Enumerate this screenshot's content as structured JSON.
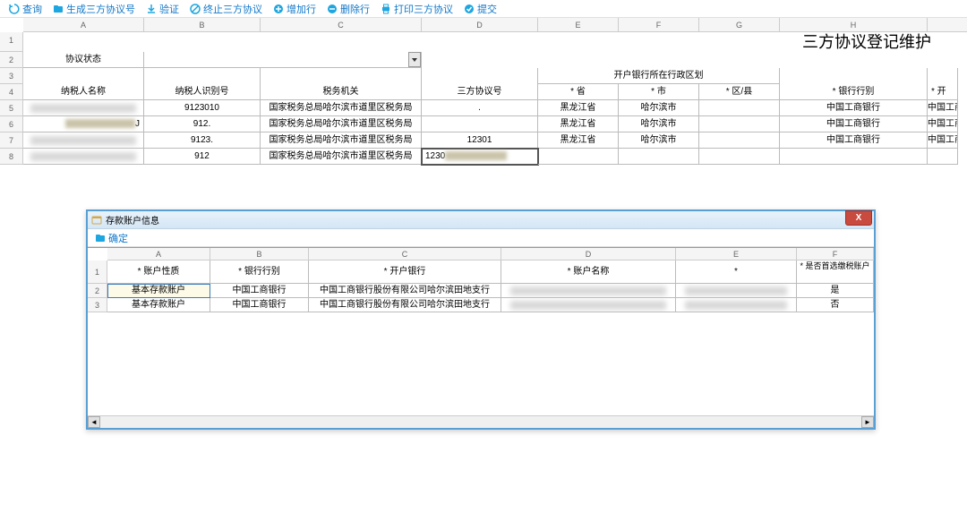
{
  "toolbar": {
    "query": "查询",
    "gen_agreement": "生成三方协议号",
    "verify": "验证",
    "terminate": "终止三方协议",
    "add_row": "增加行",
    "del_row": "删除行",
    "print": "打印三方协议",
    "submit": "提交"
  },
  "main": {
    "cols": [
      "A",
      "B",
      "C",
      "D",
      "E",
      "F",
      "G",
      "H"
    ],
    "row_nums": [
      "1",
      "2",
      "3",
      "4",
      "5",
      "6",
      "7",
      "8"
    ],
    "title": "三方协议登记维护",
    "headers": {
      "status": "协议状态",
      "taxpayer_name": "纳税人名称",
      "taxpayer_id": "纳税人识别号",
      "tax_authority": "税务机关",
      "agreement_no": "三方协议号",
      "bank_district_group": "开户银行所在行政区划",
      "province": "* 省",
      "city": "* 市",
      "county": "* 区/县",
      "bank_type": "* 银行行别",
      "open_bank": "* 开"
    },
    "rows": [
      {
        "name_blur": true,
        "id": "9123010",
        "authority": "国家税务总局哈尔滨市道里区税务局",
        "agreement": ".",
        "province": "黑龙江省",
        "city": "哈尔滨市",
        "county": "",
        "bank_type": "中国工商银行",
        "open_bank": "中国工商银行"
      },
      {
        "name_blur": true,
        "name_suffix": "J",
        "id": "912.",
        "authority": "国家税务总局哈尔滨市道里区税务局",
        "agreement": "",
        "province": "黑龙江省",
        "city": "哈尔滨市",
        "county": "",
        "bank_type": "中国工商银行",
        "open_bank": "中国工商银行"
      },
      {
        "name_blur": true,
        "id": "9123.",
        "authority": "国家税务总局哈尔滨市道里区税务局",
        "agreement": "12301",
        "province": "黑龙江省",
        "city": "哈尔滨市",
        "county": "",
        "bank_type": "中国工商银行",
        "open_bank": "中国工商银行"
      },
      {
        "name_blur": true,
        "id": "912",
        "authority": "国家税务总局哈尔滨市道里区税务局",
        "agreement": "1230",
        "agreement_blur_suffix": true,
        "province": "",
        "city": "",
        "county": "",
        "bank_type": "",
        "open_bank": ""
      }
    ]
  },
  "dialog": {
    "title": "存款账户信息",
    "confirm": "确定",
    "cols": [
      "A",
      "B",
      "C",
      "D",
      "E",
      "F"
    ],
    "row_nums": [
      "1",
      "2",
      "3"
    ],
    "headers": {
      "account_type": "* 账户性质",
      "bank_type": "* 银行行别",
      "open_bank": "* 开户银行",
      "account_name": "* 账户名称",
      "col_e": "*",
      "is_preferred": "* 是否首选缴税账户"
    },
    "rows": [
      {
        "account_type": "基本存款账户",
        "bank_type": "中国工商银行",
        "open_bank": "中国工商银行股份有限公司哈尔滨田地支行",
        "account_name_blur": true,
        "e_blur": true,
        "is_preferred": "是"
      },
      {
        "account_type": "基本存款账户",
        "bank_type": "中国工商银行",
        "open_bank": "中国工商银行股份有限公司哈尔滨田地支行",
        "account_name_blur": true,
        "e_blur": true,
        "is_preferred": "否"
      }
    ]
  }
}
